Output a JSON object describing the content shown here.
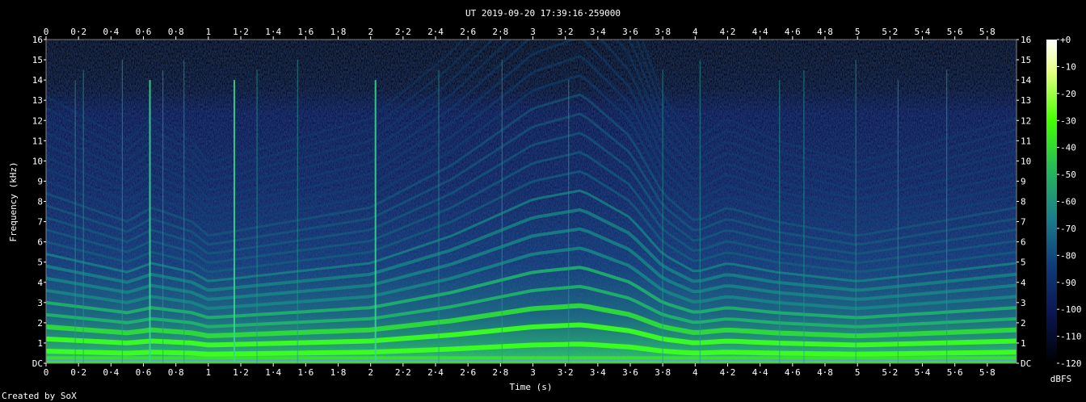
{
  "chart_data": {
    "type": "heatmap",
    "title": "UT 2019-09-20 17:39:16·259000",
    "xlabel": "Time (s)",
    "ylabel": "Frequency (kHz)",
    "xlim": [
      0,
      5.98
    ],
    "ylim": [
      0,
      16
    ],
    "x_ticks": [
      "0",
      "0·2",
      "0·4",
      "0·6",
      "0·8",
      "1",
      "1·2",
      "1·4",
      "1·6",
      "1·8",
      "2",
      "2·2",
      "2·4",
      "2·6",
      "2·8",
      "3",
      "3·2",
      "3·4",
      "3·6",
      "3·8",
      "4",
      "4·2",
      "4·4",
      "4·6",
      "4·8",
      "5",
      "5·2",
      "5·4",
      "5·6",
      "5·8"
    ],
    "y_ticks_left": [
      "DC",
      "1",
      "2",
      "3",
      "4",
      "5",
      "6",
      "7",
      "8",
      "9",
      "10",
      "11",
      "12",
      "13",
      "14",
      "15",
      "16"
    ],
    "y_ticks_right": [
      "DC",
      "1",
      "2",
      "3",
      "4",
      "5",
      "6",
      "7",
      "8",
      "9",
      "10",
      "11",
      "12",
      "13",
      "14",
      "15",
      "16"
    ],
    "colorbar": {
      "label": "dBFS",
      "ticks": [
        "+0",
        "-10",
        "-20",
        "-30",
        "-40",
        "-50",
        "-60",
        "-70",
        "-80",
        "-90",
        "-100",
        "-110",
        "-120"
      ],
      "range": [
        -120,
        0
      ]
    },
    "colors": [
      "#000000",
      "#0a1550",
      "#0f3a7a",
      "#1c7d8a",
      "#25b85a",
      "#44ff00",
      "#e6ff80",
      "#ffffff"
    ],
    "formants": [
      {
        "t": [
          0,
          0.5,
          0.65,
          0.9,
          1.0,
          1.5,
          2.0,
          2.5,
          3.0,
          3.3,
          3.6,
          3.8,
          4.0,
          4.2,
          4.5,
          5.0,
          5.5,
          5.98
        ],
        "f": [
          0.6,
          0.5,
          0.55,
          0.5,
          0.45,
          0.5,
          0.55,
          0.7,
          0.9,
          0.95,
          0.8,
          0.6,
          0.5,
          0.55,
          0.5,
          0.45,
          0.5,
          0.55
        ]
      }
    ],
    "annotations": [
      "Created by SoX"
    ]
  }
}
